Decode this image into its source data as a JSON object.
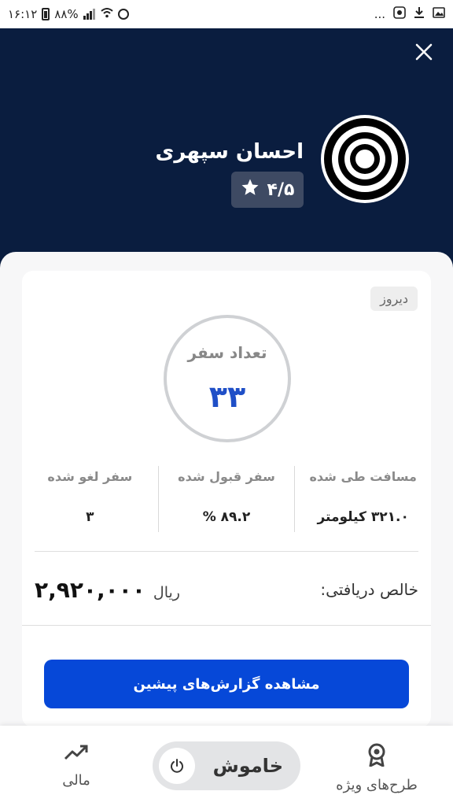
{
  "status_bar": {
    "time": "۱۶:۱۲",
    "battery": "۸۸%",
    "more": "..."
  },
  "header": {
    "driver_name": "احسان سپهری",
    "rating": "۴/۵",
    "close_icon": "close-icon",
    "avatar_icon": "target-icon"
  },
  "card": {
    "period": "دیروز",
    "trips_label": "تعداد سفر",
    "trips_value": "۳۳",
    "stats": [
      {
        "label": "مسافت طی شده",
        "value": "۳۲۱.۰ کیلومتر"
      },
      {
        "label": "سفر قبول شده",
        "value": "۸۹.۲ %"
      },
      {
        "label": "سفر لغو شده",
        "value": "۳"
      }
    ],
    "income_label": "خالص دریافتی:",
    "income_amount": "۲,۹۲۰,۰۰۰",
    "income_unit": "ریال",
    "history_button": "مشاهده گزارش‌های پیشین"
  },
  "bottom_nav": {
    "finance_label": "مالی",
    "toggle_label": "خاموش",
    "plans_label": "طرح‌های ویژه"
  },
  "colors": {
    "header_bg": "#0a1d3f",
    "accent_blue": "#0648d8",
    "trips_blue": "#1f4fc7"
  }
}
